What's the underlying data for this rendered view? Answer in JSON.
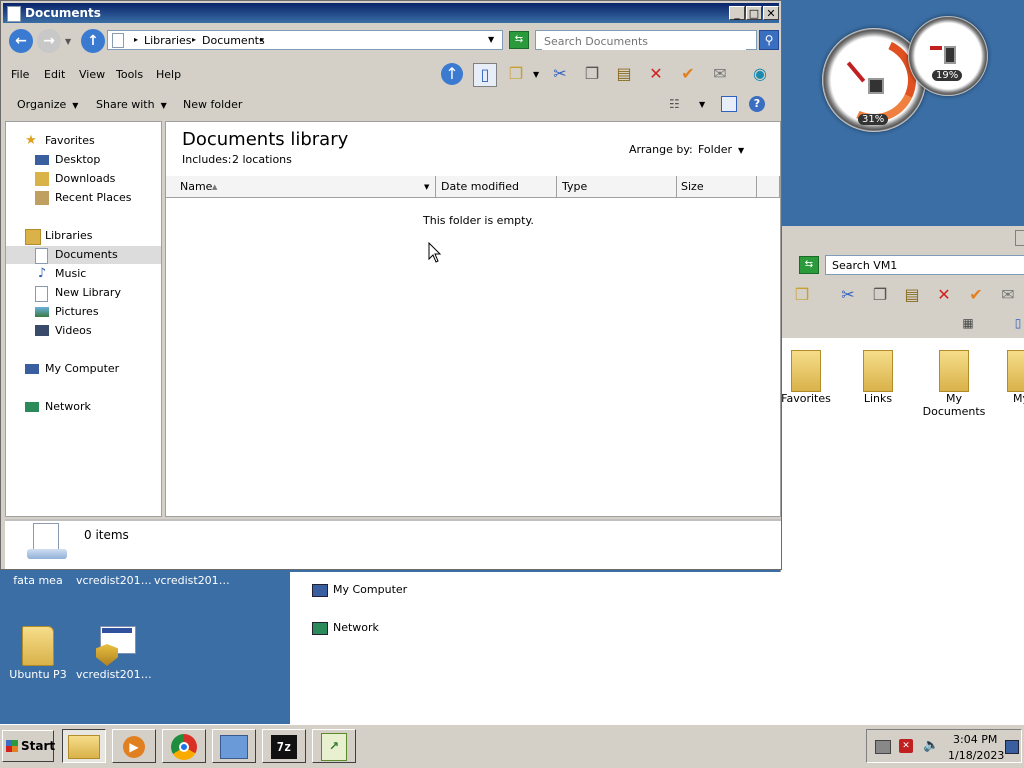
{
  "desktop": {
    "icons": [
      {
        "label": "fata mea"
      },
      {
        "label": "vcredist2010..."
      },
      {
        "label": "vcredist2015..."
      },
      {
        "label": "Ubuntu P3"
      },
      {
        "label": "vcredist2010..."
      }
    ]
  },
  "gadget": {
    "cpu_pct": "31%",
    "mem_pct": "19%"
  },
  "bg_window": {
    "search_placeholder": "Search VM1",
    "folders": [
      {
        "label": "Favorites"
      },
      {
        "label": "Links"
      },
      {
        "label": "My Documents"
      },
      {
        "label": "My"
      }
    ],
    "nav": [
      {
        "label": "My Computer"
      },
      {
        "label": "Network"
      }
    ]
  },
  "window": {
    "title": "Documents",
    "controls": {
      "minimize": "_",
      "maximize": "□",
      "close": "✕"
    },
    "breadcrumb": [
      "Libraries",
      "Documents"
    ],
    "search_placeholder": "Search Documents",
    "menu": [
      "File",
      "Edit",
      "View",
      "Tools",
      "Help"
    ],
    "commands": {
      "organize": "Organize",
      "share_with": "Share with",
      "new_folder": "New folder"
    },
    "nav": {
      "favorites": "Favorites",
      "desktop": "Desktop",
      "downloads": "Downloads",
      "recent": "Recent Places",
      "libraries": "Libraries",
      "documents": "Documents",
      "music": "Music",
      "new_library": "New Library",
      "pictures": "Pictures",
      "videos": "Videos",
      "computer": "My Computer",
      "network": "Network"
    },
    "content": {
      "library_title": "Documents library",
      "includes": "Includes:",
      "locations": "2 locations",
      "arrange_label": "Arrange by:",
      "arrange_value": "Folder",
      "columns": [
        "Name",
        "Date modified",
        "Type",
        "Size"
      ],
      "empty_message": "This folder is empty."
    },
    "status": {
      "items": "0 items"
    }
  },
  "taskbar": {
    "start": "Start",
    "time": "3:04 PM",
    "date": "1/18/2023"
  }
}
